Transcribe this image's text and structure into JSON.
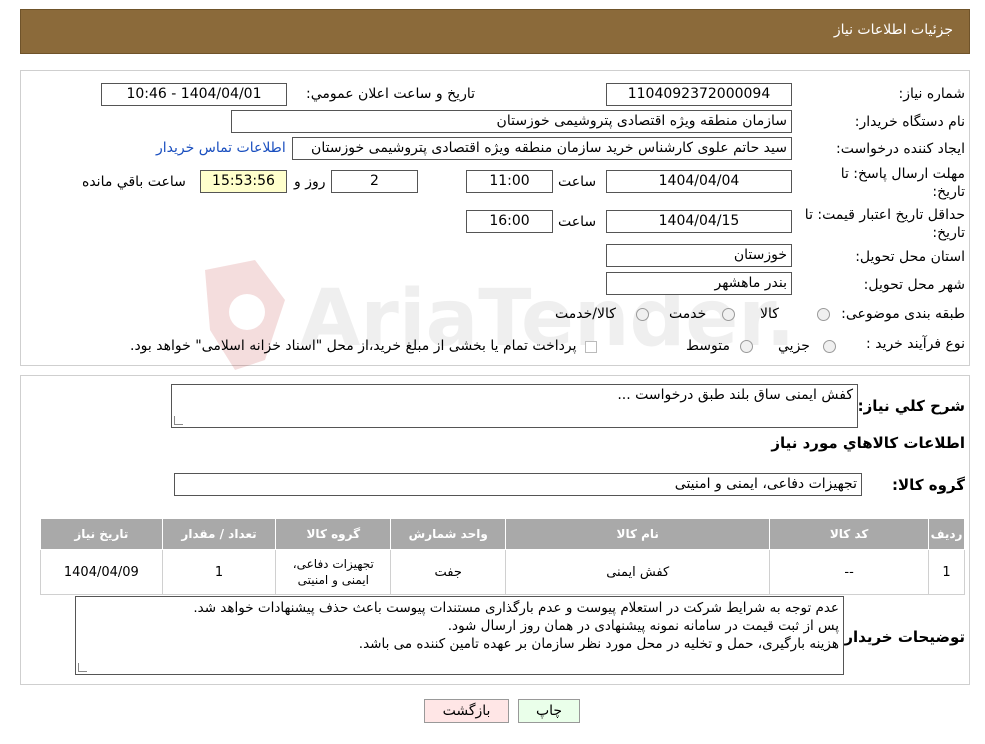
{
  "header": {
    "title": "جزئیات اطلاعات نیاز"
  },
  "form": {
    "need_number_label": "شماره نیاز:",
    "need_number": "1104092372000094",
    "announce_label": "تاریخ و ساعت اعلان عمومي:",
    "announce_value": "1404/04/01 - 10:46",
    "buyer_org_label": "نام دستگاه خريدار:",
    "buyer_org": "سازمان منطقه ویژه اقتصادی پتروشیمی خوزستان",
    "requester_label": "ايجاد کننده درخواست:",
    "requester": "سید حاتم علوی کارشناس خرید سازمان منطقه ویژه اقتصادی پتروشیمی خوزستان",
    "contact_link": "اطلاعات تماس خريدار",
    "deadline_label": "مهلت ارسال پاسخ: تا تاريخ:",
    "deadline_date": "1404/04/04",
    "time_label": "ساعت",
    "deadline_time": "11:00",
    "days": "2",
    "days_label": "روز و",
    "remaining_time": "15:53:56",
    "remaining_label": "ساعت باقي مانده",
    "validity_label": "حداقل تاريخ اعتبار قيمت: تا تاريخ:",
    "validity_date": "1404/04/15",
    "validity_time": "16:00",
    "province_label": "استان محل تحويل:",
    "province": "خوزستان",
    "city_label": "شهر محل تحويل:",
    "city": "بندر ماهشهر",
    "category_label": "طبقه بندی موضوعی:",
    "category_options": [
      "کالا",
      "خدمت",
      "کالا/خدمت"
    ],
    "process_label": "نوع فرآيند خريد :",
    "process_options": [
      "جزيي",
      "متوسط"
    ],
    "process_note": "پرداخت تمام يا بخشی از مبلغ خريد،از محل \"اسناد خزانه اسلامی\" خواهد بود."
  },
  "details": {
    "description_label": "شرح کلي نياز:",
    "description": "کفش ایمنی  ساق بلند طبق درخواست ...",
    "goods_info_title": "اطلاعات کالاهاي مورد نياز",
    "goods_group_label": "گروه کالا:",
    "goods_group": "تجهیزات دفاعی، ایمنی و امنیتی",
    "table": {
      "headers": [
        "رديف",
        "کد کالا",
        "نام کالا",
        "واحد شمارش",
        "گروه کالا",
        "تعداد / مقدار",
        "تاريخ نياز"
      ],
      "rows": [
        [
          "1",
          "--",
          "کفش ایمنی",
          "جفت",
          "تجهیزات دفاعی، ایمنی و امنیتی",
          "1",
          "1404/04/09"
        ]
      ]
    },
    "buyer_notes_label": "توضيحات خريدار:",
    "buyer_notes": [
      "عدم توجه به شرایط شرکت در استعلام پیوست و عدم بارگذاری مستندات پیوست باعث حذف پیشنهادات خواهد شد.",
      "پس از ثبت قیمت در سامانه نمونه پیشنهادی در همان روز ارسال شود.",
      "هزینه بارگیری، حمل و تخلیه در محل مورد نظر سازمان بر عهده تامین کننده می باشد."
    ]
  },
  "buttons": {
    "print": "چاپ",
    "back": "بازگشت"
  },
  "watermark": {
    "text": "AriaTender.neT"
  },
  "colors": {
    "header_bg": "#8b6a3a",
    "print_bg": "#eaffea",
    "back_bg": "#ffe6e6",
    "table_header_bg": "#a9a9a9"
  }
}
